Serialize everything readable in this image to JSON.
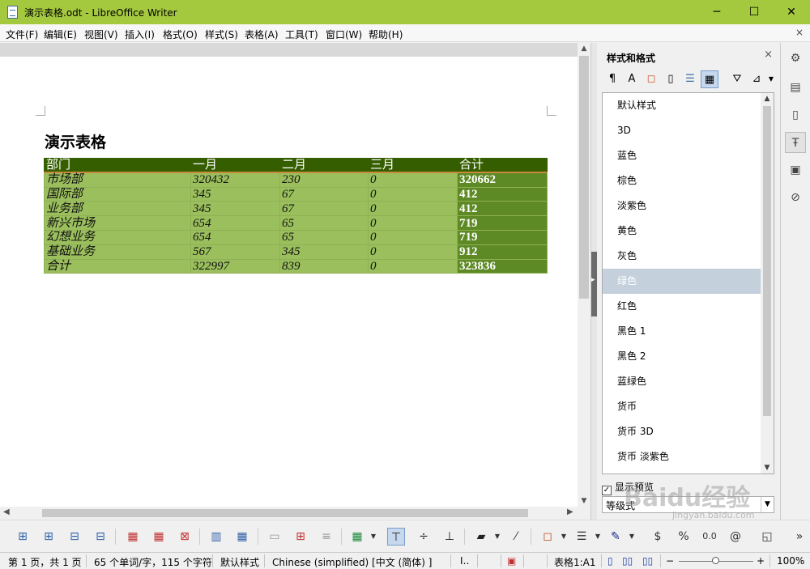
{
  "window": {
    "title": "演示表格.odt - LibreOffice Writer",
    "minimize_icon": "─",
    "maximize_icon": "☐",
    "close_icon": "✕"
  },
  "menubar": {
    "items": [
      "文件(F)",
      "编辑(E)",
      "视图(V)",
      "插入(I)",
      "格式(O)",
      "样式(S)",
      "表格(A)",
      "工具(T)",
      "窗口(W)",
      "帮助(H)"
    ],
    "close_doc": "×"
  },
  "document": {
    "heading": "演示表格",
    "table": {
      "headers": [
        "部门",
        "一月",
        "二月",
        "三月",
        "合计"
      ],
      "rows": [
        [
          "市场部",
          "320432",
          "230",
          "0",
          "320662"
        ],
        [
          "国际部",
          "345",
          "67",
          "0",
          "412"
        ],
        [
          "业务部",
          "345",
          "67",
          "0",
          "412"
        ],
        [
          "新兴市场",
          "654",
          "65",
          "0",
          "719"
        ],
        [
          "幻想业务",
          "654",
          "65",
          "0",
          "719"
        ],
        [
          "基础业务",
          "567",
          "345",
          "0",
          "912"
        ],
        [
          "合计",
          "322997",
          "839",
          "0",
          "323836"
        ]
      ]
    }
  },
  "sidebar": {
    "title": "样式和格式",
    "close": "×",
    "styles": [
      "默认样式",
      "3D",
      "蓝色",
      "棕色",
      "淡紫色",
      "黄色",
      "灰色",
      "绿色",
      "红色",
      "黑色 1",
      "黑色 2",
      "蓝绿色",
      "货币",
      "货币 3D",
      "货币 淡紫色"
    ],
    "selected_style": "绿色",
    "show_preview_label": "显示预览",
    "show_preview_checked": true,
    "filter_value": "等级式"
  },
  "statusbar": {
    "page": "第 1 页，共 1 页",
    "words": "65 个单词/字，115 个字符",
    "page_style": "默认样式",
    "language": "Chinese (simplified) [中文 (简体) ]",
    "table_cell": "表格1:A1",
    "zoom": "100%"
  },
  "watermark": {
    "text": "Baidu经验",
    "sub": "jingyan.baidu.com"
  },
  "colors": {
    "titlebar": "#a5c93e",
    "table_header": "#355e00",
    "table_body": "#9bbf5d",
    "table_sum": "#5e8a25",
    "selected_style": "#c4d1dc"
  }
}
